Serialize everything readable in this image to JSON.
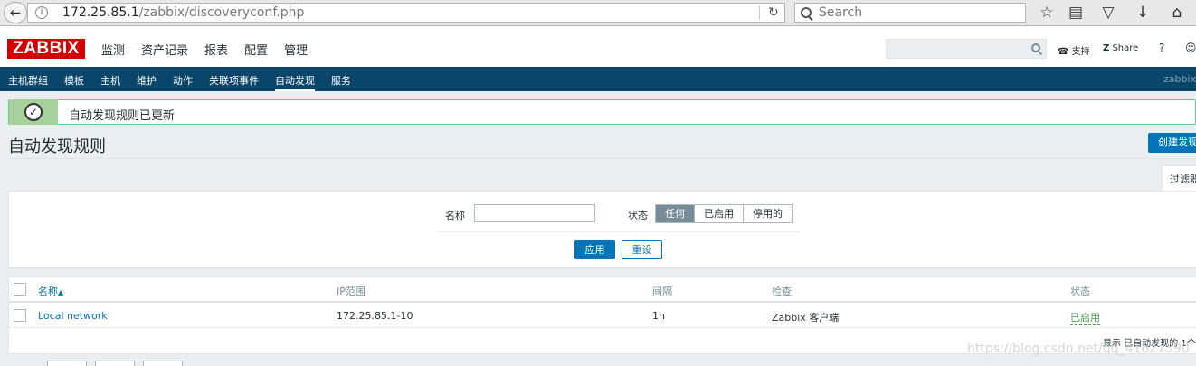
{
  "browser": {
    "url_host": "172.25.85.1",
    "url_path": "/zabbix/discoveryconf.php",
    "search_placeholder": "Search"
  },
  "header": {
    "logo": "ZABBIX",
    "menu": [
      "监测",
      "资产记录",
      "报表",
      "配置",
      "管理"
    ],
    "support": "支持",
    "share": "Share",
    "help": "?"
  },
  "subnav": {
    "items": [
      "主机群组",
      "模板",
      "主机",
      "维护",
      "动作",
      "关联项事件",
      "自动发现",
      "服务"
    ],
    "right": "zabbix"
  },
  "message": {
    "text": "自动发现规则已更新"
  },
  "page": {
    "title": "自动发现规则",
    "create_button": "创建发现"
  },
  "filter": {
    "tab": "过滤器",
    "name_label": "名称",
    "name_value": "",
    "status_label": "状态",
    "status_options": [
      "任何",
      "已启用",
      "停用的"
    ],
    "status_selected": "任何",
    "apply": "应用",
    "reset": "重设"
  },
  "table": {
    "headers": {
      "name": "名称",
      "sort_arrow": "▲",
      "ip_range": "IP范围",
      "interval": "间隔",
      "checks": "检查",
      "status": "状态"
    },
    "rows": [
      {
        "name": "Local network",
        "ip_range": "172.25.85.1-10",
        "interval": "1h",
        "checks": "Zabbix 客户端",
        "status": "已启用"
      }
    ],
    "footer": "显示 已自动发现的 1个"
  },
  "watermark": "https://blog.csdn.net/qq_41627390"
}
